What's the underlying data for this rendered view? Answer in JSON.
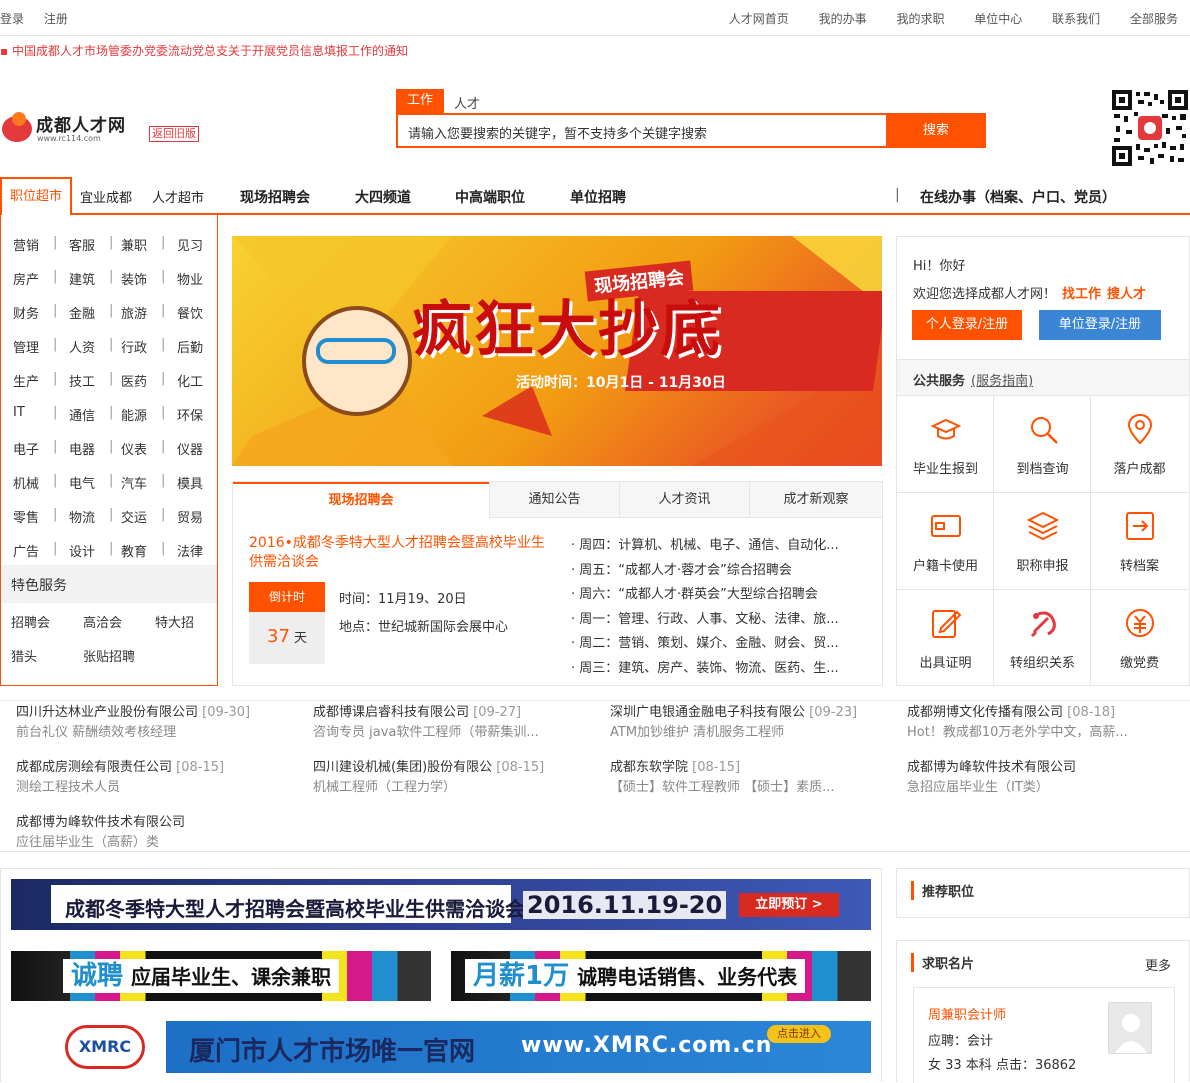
{
  "topbar": {
    "left": [
      "登录",
      "注册"
    ],
    "right": [
      "人才网首页",
      "我的办事",
      "我的求职",
      "单位中心",
      "联系我们",
      "全部服务"
    ]
  },
  "notice": "中国成都人才市场管委办党委流动党总支关于开展党员信息填报工作的通知",
  "logo": {
    "name": "成都人才网",
    "url": "www.rc114.com",
    "old_version": "返回旧版"
  },
  "search": {
    "tabs": [
      "工作",
      "人才"
    ],
    "placeholder": "请输入您要搜索的关键字，暂不支持多个关键字搜索",
    "button": "搜索"
  },
  "nav": {
    "active": "职位超市",
    "items": [
      "宜业成都",
      "人才超市",
      "现场招聘会",
      "大四频道",
      "中高端职位",
      "单位招聘"
    ],
    "separator": "|",
    "online": "在线办事（档案、户口、党员）"
  },
  "categories": [
    [
      "营销",
      "客服",
      "兼职",
      "见习"
    ],
    [
      "房产",
      "建筑",
      "装饰",
      "物业"
    ],
    [
      "财务",
      "金融",
      "旅游",
      "餐饮"
    ],
    [
      "管理",
      "人资",
      "行政",
      "后勤"
    ],
    [
      "生产",
      "技工",
      "医药",
      "化工"
    ],
    [
      "IT",
      "通信",
      "能源",
      "环保"
    ],
    [
      "电子",
      "电器",
      "仪表",
      "仪器"
    ],
    [
      "机械",
      "电气",
      "汽车",
      "模具"
    ],
    [
      "零售",
      "物流",
      "交运",
      "贸易"
    ],
    [
      "广告",
      "设计",
      "教育",
      "法律"
    ]
  ],
  "category_sep": "|",
  "featured": {
    "title": "特色服务",
    "items": [
      "招聘会",
      "高洽会",
      "特大招",
      "猎头",
      "张贴招聘"
    ]
  },
  "banner": {
    "tag": "现场招聘会",
    "headline": "疯狂大抄底",
    "time": "活动时间：10月1日 - 11月30日"
  },
  "news_tabs": [
    "现场招聘会",
    "通知公告",
    "人才资讯",
    "成才新观察"
  ],
  "fair": {
    "title": "2016•成都冬季特大型人才招聘会暨高校毕业生供需洽谈会",
    "countdown_label": "倒计时",
    "days": "37",
    "days_unit": "天",
    "time": "时间：11月19、20日",
    "place": "地点：世纪城新国际会展中心"
  },
  "week": [
    "· 周四：计算机、机械、电子、通信、自动化...",
    "· 周五：“成都人才·蓉才会”综合招聘会",
    "· 周六：“成都人才·群英会”大型综合招聘会",
    "· 周一：管理、行政、人事、文秘、法律、旅...",
    "· 周二：营销、策划、媒介、金融、财会、贸...",
    "· 周三：建筑、房产、装饰、物流、医药、生..."
  ],
  "side": {
    "hi": "Hi！你好",
    "welcome": "欢迎您选择成都人才网！",
    "find_job": "找工作",
    "find_talent": "搜人才",
    "login_person": "个人登录/注册",
    "login_unit": "单位登录/注册",
    "public": "公共服务",
    "guide": "(服务指南)",
    "services": [
      "毕业生报到",
      "到档查询",
      "落户成都",
      "户籍卡使用",
      "职称申报",
      "转档案",
      "出具证明",
      "转组织关系",
      "缴党费"
    ]
  },
  "enterprises": [
    {
      "name": "四川升达林业产业股份有限公司",
      "date": "[09-30]",
      "jobs": "前台礼仪 薪酬绩效考核经理"
    },
    {
      "name": "成都博课启睿科技有限公司",
      "date": "[09-27]",
      "jobs": "咨询专员 java软件工程师（带薪集训..."
    },
    {
      "name": "深圳广电银通金融电子科技有限公",
      "date": "[09-23]",
      "jobs": "ATM加钞维护 清机服务工程师"
    },
    {
      "name": "成都朔博文化传播有限公司",
      "date": "[08-18]",
      "jobs": "Hot！教成都10万老外学中文，高薪..."
    },
    {
      "name": "成都成房测绘有限责任公司",
      "date": "[08-15]",
      "jobs": "测绘工程技术人员"
    },
    {
      "name": "四川建设机械(集团)股份有限公",
      "date": "[08-15]",
      "jobs": "机械工程师（工程力学）"
    },
    {
      "name": "成都东软学院",
      "date": "[08-15]",
      "jobs": "【硕士】软件工程教师 【硕士】素质..."
    },
    {
      "name": "成都博为峰软件技术有限公司",
      "date": "",
      "jobs": "急招应届毕业生（IT类）"
    },
    {
      "name": "成都博为峰软件技术有限公司",
      "date": "",
      "jobs": "应往届毕业生（高薪）类"
    }
  ],
  "ads": {
    "ad1_title": "成都冬季特大型人才招聘会暨高校毕业生供需洽谈会",
    "ad1_date": "2016.11.19-20",
    "ad1_btn": "立即预订 >",
    "ad2_big": "诚聘",
    "ad2_text": "应届毕业生、课余兼职",
    "ad3_big": "月薪1万",
    "ad3_text": "诚聘电话销售、业务代表",
    "ad4_logo": "XMRC",
    "ad4_title": "厦门市人才市场唯一官网",
    "ad4_url": "www.XMRC.com.cn",
    "ad4_click": "点击进入"
  },
  "recommend": {
    "title": "推荐职位"
  },
  "card": {
    "title": "求职名片",
    "more": "更多",
    "name": "周兼职会计师",
    "apply": "应聘：会计",
    "meta": "女 33 本科 点击：36862"
  },
  "colors": {
    "accent": "#ff5200",
    "blue": "#3b86d4",
    "red": "#e4393c"
  }
}
